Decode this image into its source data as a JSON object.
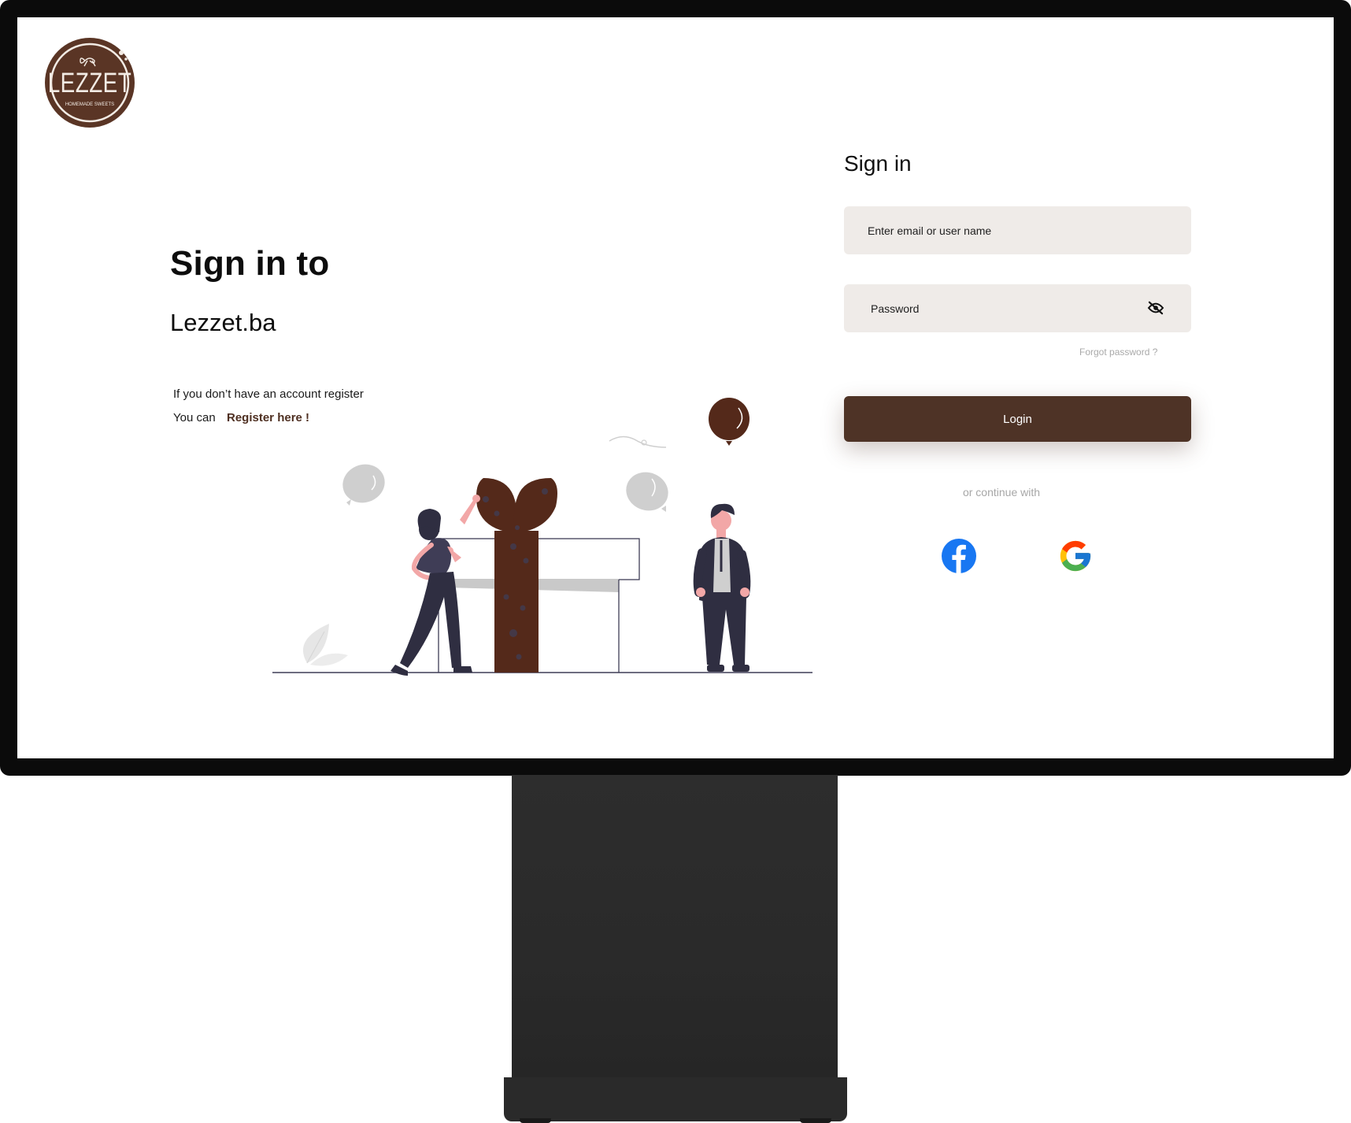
{
  "brand": {
    "logo_text": "LEZZET",
    "logo_subtext": "HOMEMADE SWEETS"
  },
  "hero": {
    "title": "Sign in to",
    "subtitle": "Lezzet.ba",
    "register_prompt": "If you don’t have an account register",
    "register_prefix": "You can",
    "register_link": "Register here !"
  },
  "form": {
    "title": "Sign in",
    "email_placeholder": "Enter email or user name",
    "password_placeholder": "Password",
    "forgot_label": "Forgot password ?",
    "login_label": "Login",
    "continue_label": "or continue with"
  },
  "social": [
    {
      "name": "facebook",
      "icon": "facebook-icon"
    },
    {
      "name": "google",
      "icon": "google-icon"
    }
  ],
  "colors": {
    "brand_brown": "#4e3326",
    "input_bg": "#efebe8",
    "facebook_blue": "#1877f2",
    "muted_text": "#a7a7a7"
  }
}
